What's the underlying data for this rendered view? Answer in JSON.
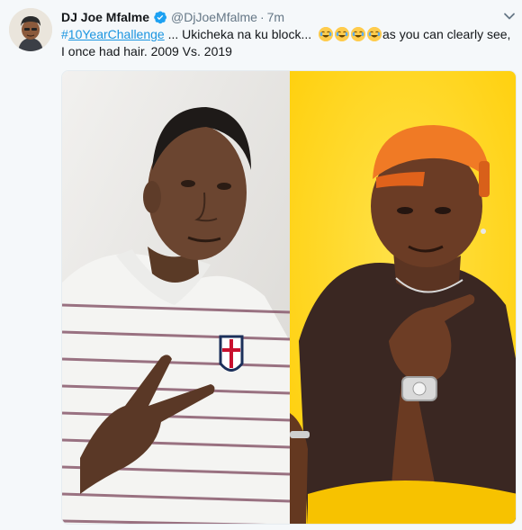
{
  "tweet": {
    "display_name": "DJ Joe Mfalme",
    "handle": "@DjJoeMfalme",
    "separator": "·",
    "time": "7m",
    "verified_icon": "verified-badge-icon",
    "more_icon": "chevron-down-icon",
    "hashtag_symbol": "#",
    "hashtag_text": "10YearChallenge",
    "text_part1": " ... Ukicheka na ku block... ",
    "emojis": [
      "😂",
      "😂",
      "😂",
      "😂"
    ],
    "text_part2": "as you can clearly see, I once had hair. 2009 Vs. 2019"
  },
  "colors": {
    "link": "#1b95e0",
    "verified": "#1da1f2",
    "secondary_text": "#657786",
    "right_background": "#ffd400",
    "left_background": "#e8e6e3"
  }
}
